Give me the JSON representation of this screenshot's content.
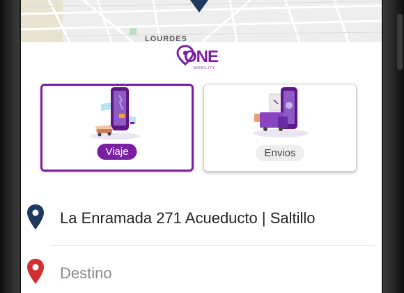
{
  "map": {
    "area_label": "LOURDES"
  },
  "logo": {
    "brand": "ONE",
    "subtitle": "MOBILITY"
  },
  "services": [
    {
      "label": "Viaje",
      "selected": true,
      "illustration_icon": "phone-car-illustration"
    },
    {
      "label": "Envios",
      "selected": false,
      "illustration_icon": "phone-delivery-truck-illustration"
    }
  ],
  "origin": {
    "text": "La Enramada 271 Acueducto | Saltillo",
    "icon": "location-pin-icon",
    "color": "#1e3a5f"
  },
  "destination": {
    "placeholder": "Destino",
    "icon": "location-pin-icon",
    "color": "#d32f2f"
  },
  "colors": {
    "accent": "#7b1fa2",
    "origin_pin": "#1e3a5f",
    "destination_pin": "#d32f2f"
  }
}
